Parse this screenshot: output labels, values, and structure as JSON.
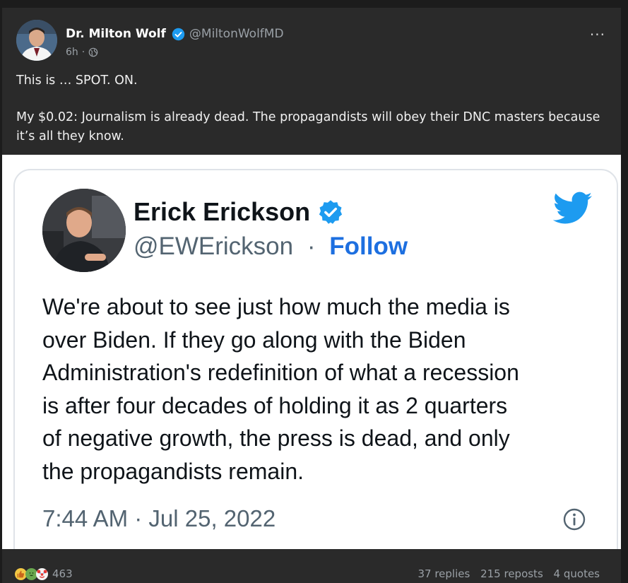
{
  "post": {
    "author_name": "Dr. Milton Wolf",
    "author_handle": "@MiltonWolfMD",
    "time": "6h",
    "more_label": "···",
    "text_line1": "This is … SPOT. ON.",
    "text_line2": "My $0.02: Journalism is already dead. The propagandists will obey their DNC masters because it’s all they know."
  },
  "embed": {
    "name": "Erick Erickson",
    "handle": "@EWErickson",
    "separator": "·",
    "follow_label": "Follow",
    "text": "We're about to see just how much the media is\nover Biden.  If they go along with the Biden\nAdministration's redefinition of what a recession\nis after four decades of holding it as 2 quarters\nof negative growth, the press is dead, and only\nthe propagandists remain.",
    "timestamp": "7:44 AM · Jul 25, 2022"
  },
  "footer": {
    "reactions": [
      "thumbs-up-icon",
      "grinning-face-icon",
      "clown-face-icon"
    ],
    "reaction_count": "463",
    "replies": "37 replies",
    "reposts": "215 reposts",
    "quotes": "4 quotes"
  },
  "colors": {
    "verified": "#1d9bf0",
    "follow": "#1d6fe0",
    "twitter_bird": "#1d9bf0",
    "page_bg": "#1c1c1c",
    "post_bg": "#2a2a2a"
  }
}
